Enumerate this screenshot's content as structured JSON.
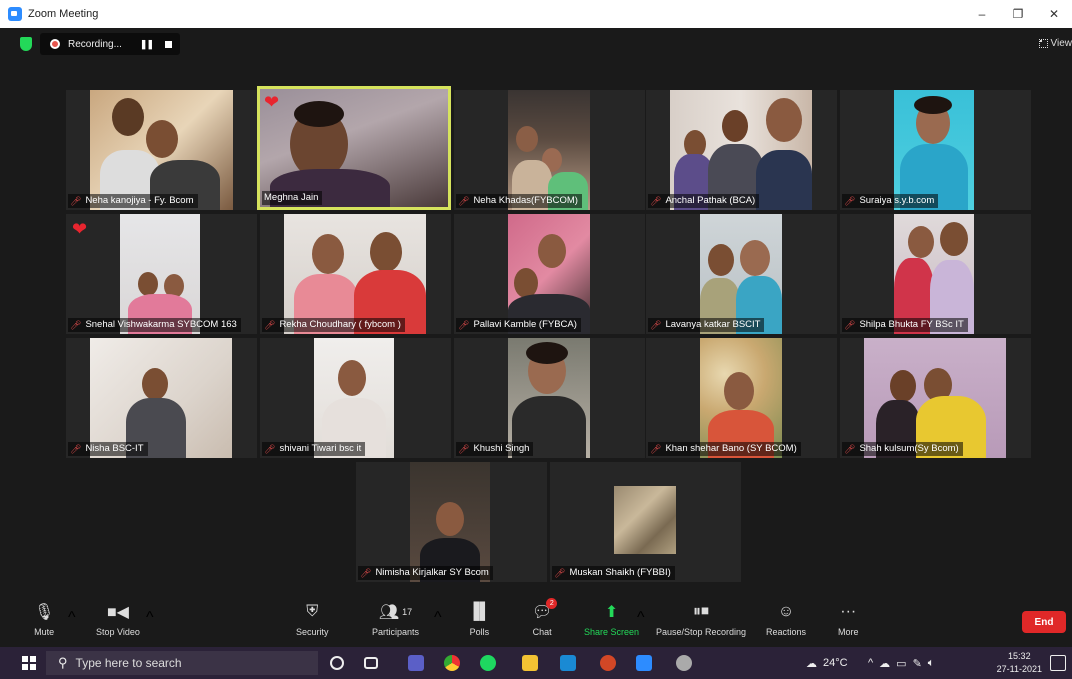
{
  "window": {
    "title": "Zoom Meeting",
    "controls": [
      "–",
      "❐",
      "✕"
    ]
  },
  "recording": {
    "label": "Recording...",
    "pause": "❚❚"
  },
  "view": {
    "label": "View"
  },
  "participants": [
    {
      "name": "Neha kanojiya - Fy. Bcom"
    },
    {
      "name": "Meghna Jain",
      "active": true
    },
    {
      "name": "Neha Khadas(FYBCOM)"
    },
    {
      "name": "Anchal Pathak (BCA)"
    },
    {
      "name": "Suraiya s.y.b.com"
    },
    {
      "name": "Snehal Vishwakarma SYBCOM 163"
    },
    {
      "name": "Rekha Choudhary ( fybcom )"
    },
    {
      "name": "Pallavi Kamble (FYBCA)"
    },
    {
      "name": "Lavanya katkar  BSCIT"
    },
    {
      "name": "Shilpa Bhukta FY BSc IT"
    },
    {
      "name": "Nisha BSC-IT"
    },
    {
      "name": "shivani Tiwari bsc it"
    },
    {
      "name": "Khushi Singh"
    },
    {
      "name": "Khan shehar Bano (SY BCOM)"
    },
    {
      "name": "Shah kulsum(Sy Bcom)"
    },
    {
      "name": "Nimisha Kirjalkar SY Bcom"
    },
    {
      "name": "Muskan Shaikh (FYBBI)"
    }
  ],
  "toolbar": {
    "mute": "Mute",
    "stop_video": "Stop Video",
    "security": "Security",
    "participants": "Participants",
    "participants_count": "17",
    "polls": "Polls",
    "chat": "Chat",
    "chat_badge": "2",
    "share_screen": "Share Screen",
    "pause_stop_recording": "Pause/Stop Recording",
    "reactions": "Reactions",
    "more": "More",
    "end": "End"
  },
  "colors": {
    "share_green": "#23d959",
    "end_red": "#e02828",
    "active_border": "#d6e35d"
  },
  "taskbar": {
    "search_placeholder": "Type here to search",
    "temperature": "24°C",
    "time": "15:32",
    "date": "27-11-2021"
  }
}
